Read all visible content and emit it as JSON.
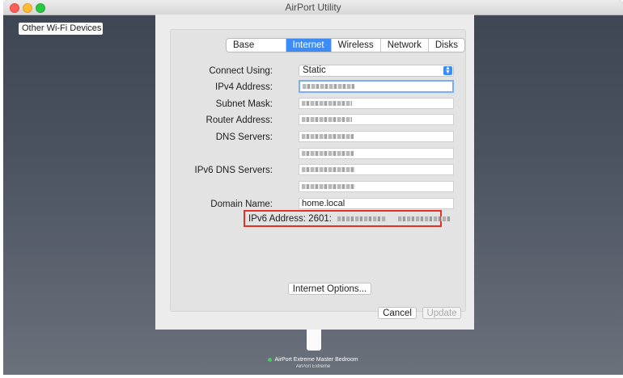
{
  "window": {
    "title": "AirPort Utility"
  },
  "sidebar": {
    "other_devices": "Other Wi-Fi Devices"
  },
  "tabs": [
    "Base Station",
    "Internet",
    "Wireless",
    "Network",
    "Disks"
  ],
  "active_tab": "Internet",
  "form": {
    "connect_using_label": "Connect Using:",
    "connect_using_value": "Static",
    "ipv4_label": "IPv4 Address:",
    "subnet_label": "Subnet Mask:",
    "router_label": "Router Address:",
    "dns_label": "DNS Servers:",
    "ipv6_dns_label": "IPv6 DNS Servers:",
    "domain_label": "Domain Name:",
    "domain_value": "home.local",
    "ipv6_address_label": "IPv6 Address:",
    "ipv6_address_value": "2601:"
  },
  "buttons": {
    "internet_options": "Internet Options...",
    "cancel": "Cancel",
    "update": "Update"
  },
  "device": {
    "name": "AirPort Extreme Master Bedroom",
    "model": "AirPort Extreme"
  },
  "colors": {
    "accent": "#3d8bf7",
    "highlight": "#e53123",
    "status": "#3ed15a"
  }
}
